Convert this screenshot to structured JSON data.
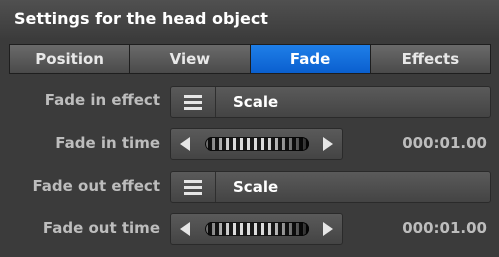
{
  "panel": {
    "title": "Settings for the head object",
    "tabs": [
      {
        "label": "Position",
        "active": false
      },
      {
        "label": "View",
        "active": false
      },
      {
        "label": "Fade",
        "active": true
      },
      {
        "label": "Effects",
        "active": false
      }
    ]
  },
  "fields": {
    "fade_in_effect": {
      "label": "Fade in effect",
      "value": "Scale"
    },
    "fade_in_time": {
      "label": "Fade in time",
      "value": "000:01.00"
    },
    "fade_out_effect": {
      "label": "Fade out effect",
      "value": "Scale"
    },
    "fade_out_time": {
      "label": "Fade out time",
      "value": "000:01.00"
    }
  },
  "colors": {
    "panel_bg": "#3b3b3b",
    "active_tab": "#1170e0",
    "label_text": "#bdbdbd"
  },
  "icons": {
    "dropdown": "menu-lines-icon",
    "decrement": "arrow-left-icon",
    "increment": "arrow-right-icon"
  }
}
